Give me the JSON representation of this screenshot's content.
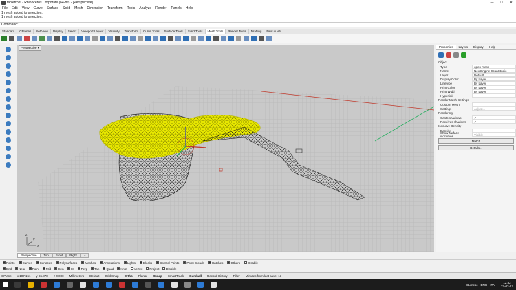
{
  "window": {
    "title": "tablefront - Rhinoceros Corporate (64-bit) - [Perspective]",
    "controls": [
      "—",
      "☐",
      "✕"
    ]
  },
  "menu": [
    "File",
    "Edit",
    "View",
    "Curve",
    "Surface",
    "Solid",
    "Mesh",
    "Dimension",
    "Transform",
    "Tools",
    "Analyze",
    "Render",
    "Panels",
    "Help"
  ],
  "history": [
    "1 mesh added to selection.",
    "1 mesh added to selection."
  ],
  "command": {
    "label": "Command:"
  },
  "toolbar_tabs": [
    "Standard",
    "CPlanes",
    "Set View",
    "Display",
    "Select",
    "Viewport Layout",
    "Visibility",
    "Transform",
    "Curve Tools",
    "Surface Tools",
    "Solid Tools",
    "Mesh Tools",
    "Render Tools",
    "Drafting",
    "New in V5"
  ],
  "active_toolbar_tab": "Mesh Tools",
  "viewport": {
    "label": "Perspective ▾",
    "tabs": [
      "Perspective",
      "Top",
      "Front",
      "Right",
      "+"
    ],
    "axes": {
      "x": "x",
      "y": "y",
      "z": "z"
    }
  },
  "right_panel": {
    "tabs": [
      "Properties",
      "Layers",
      "Display",
      "Help"
    ],
    "object_section": "Object",
    "properties": [
      {
        "k": "Type",
        "v": "open mesh"
      },
      {
        "k": "Name",
        "v": "NextEngine ScanStudio"
      },
      {
        "k": "Layer",
        "v": "Default"
      },
      {
        "k": "Display Color",
        "v": "By Layer"
      },
      {
        "k": "Linetype",
        "v": "By Layer"
      },
      {
        "k": "Print Color",
        "v": "By Layer"
      },
      {
        "k": "Print Width",
        "v": "By Layer"
      },
      {
        "k": "Hyperlink",
        "v": ""
      }
    ],
    "render_mesh_section": "Render Mesh Settings",
    "render_mesh": [
      {
        "k": "Custom Mesh",
        "v": ""
      },
      {
        "k": "Settings",
        "v": "Adjust..."
      }
    ],
    "rendering_section": "Rendering",
    "rendering": [
      {
        "k": "Casts shadows",
        "v": "✓"
      },
      {
        "k": "Receives shadows",
        "v": "✓"
      }
    ],
    "isocurve_section": "Isocurve Density",
    "isocurve": [
      {
        "k": "Density",
        "v": ""
      },
      {
        "k": "Show surface isocurves",
        "v": "Visible"
      }
    ],
    "match_button": "Match",
    "details_button": "Details..."
  },
  "osnap_row1": [
    {
      "label": "Points",
      "on": true
    },
    {
      "label": "Curves",
      "on": true
    },
    {
      "label": "Surfaces",
      "on": true
    },
    {
      "label": "Polysurfaces",
      "on": true
    },
    {
      "label": "Meshes",
      "on": true
    },
    {
      "label": "Annotations",
      "on": true
    },
    {
      "label": "Lights",
      "on": true
    },
    {
      "label": "Blocks",
      "on": true
    },
    {
      "label": "Control Points",
      "on": true
    },
    {
      "label": "Point Clouds",
      "on": true
    },
    {
      "label": "Hatches",
      "on": true
    },
    {
      "label": "Others",
      "on": true
    },
    {
      "label": "Disable",
      "on": false
    }
  ],
  "osnap_row2": [
    {
      "label": "End",
      "on": true
    },
    {
      "label": "Near",
      "on": true
    },
    {
      "label": "Point",
      "on": true
    },
    {
      "label": "Mid",
      "on": true
    },
    {
      "label": "Cen",
      "on": true
    },
    {
      "label": "Int",
      "on": true
    },
    {
      "label": "Perp",
      "on": true
    },
    {
      "label": "Tan",
      "on": true
    },
    {
      "label": "Quad",
      "on": true
    },
    {
      "label": "Knot",
      "on": true
    },
    {
      "label": "Vertex",
      "on": false
    },
    {
      "label": "Project",
      "on": false
    },
    {
      "label": "Disable",
      "on": false
    }
  ],
  "status": {
    "cplane": "CPlane",
    "x": "x 107.151",
    "y": "y 65.878",
    "z": "z 0.000",
    "units": "Millimeters",
    "layer": "Default",
    "toggles": [
      "Grid Snap",
      "Ortho",
      "Planar",
      "Osnap",
      "SmartTrack",
      "Gumball",
      "Record History",
      "Filter"
    ],
    "message": "Minutes from last save: 13"
  },
  "taskbar": {
    "weather": "Bumesc",
    "lang": "ENG",
    "locale": "ITA",
    "time": "12:52",
    "date": "27-02-17"
  },
  "colors": {
    "mesh_yellow": "#e6e600",
    "grid": "#bdbdbd",
    "viewport_bg": "#c9c9c9",
    "x_axis": "#c0392b",
    "y_axis": "#27ae60"
  }
}
